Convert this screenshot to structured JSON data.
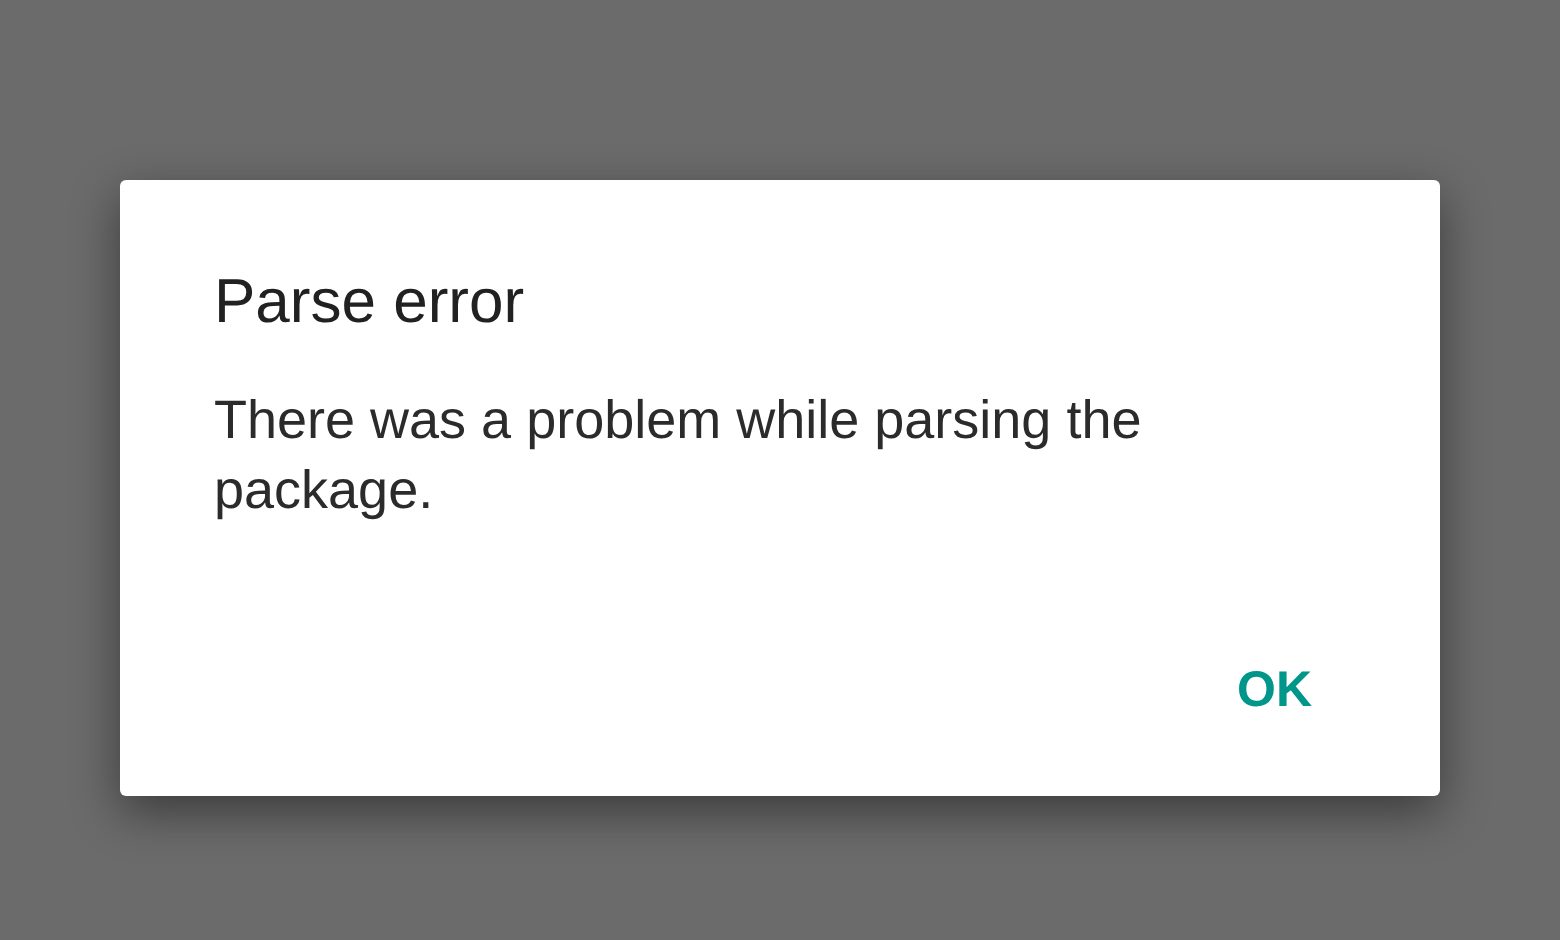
{
  "dialog": {
    "title": "Parse error",
    "message": "There was a problem while parsing the package.",
    "buttons": [
      "OK"
    ]
  }
}
